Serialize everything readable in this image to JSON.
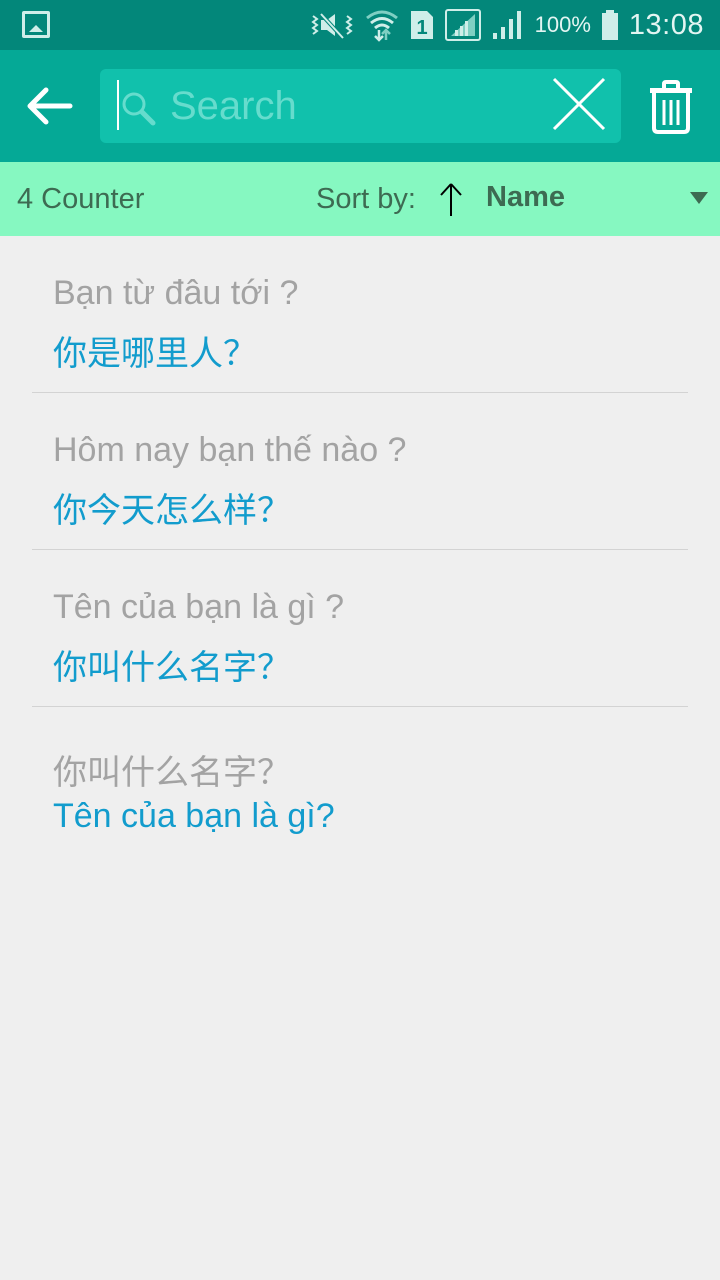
{
  "status_bar": {
    "battery_percent": "100%",
    "time": "13:08",
    "sim_slot": "1",
    "icons": [
      "gallery-notification-icon",
      "vibrate-mute-icon",
      "wifi-icon",
      "sim-1-icon",
      "signal-icon",
      "signal-icon",
      "battery-icon"
    ]
  },
  "app_bar": {
    "back_icon": "arrow-left-icon",
    "search": {
      "placeholder": "Search",
      "value": ""
    },
    "clear_icon": "close-icon",
    "delete_icon": "trash-icon"
  },
  "sort_bar": {
    "counter": "4 Counter",
    "sort_label": "Sort by:",
    "sort_direction": "ascending",
    "sort_value": "Name"
  },
  "items": [
    {
      "source": "Bạn từ đâu tới ?",
      "translation": "你是哪里人？"
    },
    {
      "source": "Hôm nay bạn thế nào ?",
      "translation": "你今天怎么样？"
    },
    {
      "source": "Tên của bạn là gì ?",
      "translation": "你叫什么名字？"
    },
    {
      "source": "你叫什么名字？",
      "translation": "Tên của bạn là gì?"
    }
  ],
  "colors": {
    "status_bar": "#03877a",
    "app_bar": "#05a996",
    "search_box": "#11c1ac",
    "sort_bar": "#86f8c1",
    "source_text": "#a3a3a3",
    "translation_text": "#129ccd",
    "background": "#efefef"
  }
}
